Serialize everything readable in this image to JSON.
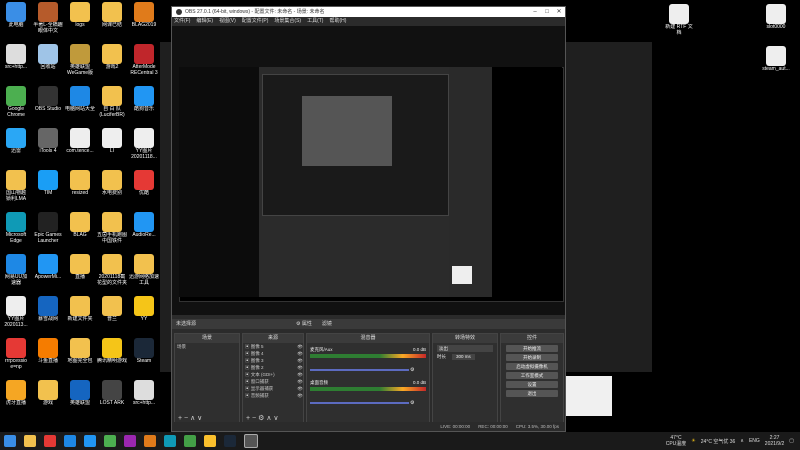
{
  "desktop_icons": [
    {
      "label": "此电脑",
      "icon": "computer-icon",
      "color": "#3a8ee6"
    },
    {
      "label": "半著L-全橋趣\n眼体中文",
      "icon": "game-icon",
      "color": "#b65b2b"
    },
    {
      "label": "logs",
      "icon": "folder-icon",
      "color": "#f2c14e"
    },
    {
      "label": "网课已结",
      "icon": "folder-icon",
      "color": "#f2c14e"
    },
    {
      "label": "BLAG2019",
      "icon": "app-icon",
      "color": "#e07b1b"
    },
    {
      "label": "src+http...",
      "icon": "file-icon",
      "color": "#ddd"
    },
    {
      "label": "回收站",
      "icon": "recycle-bin-icon",
      "color": "#9fc4e7"
    },
    {
      "label": "英雄联盟\nWeGame版",
      "icon": "game-icon",
      "color": "#c09a3b"
    },
    {
      "label": "游戏2",
      "icon": "folder-icon",
      "color": "#f2c14e"
    },
    {
      "label": "AtterMode\nRECentral 3",
      "icon": "app-icon",
      "color": "#c0262b"
    },
    {
      "label": "Google\nChrome",
      "icon": "chrome-icon",
      "color": "#4caf50"
    },
    {
      "label": "OBS Studio",
      "icon": "obs-icon",
      "color": "#333"
    },
    {
      "label": "电脑网站大全",
      "icon": "ie-icon",
      "color": "#1e88e5"
    },
    {
      "label": "自 白 队\n(LuciferBR)",
      "icon": "folder-icon",
      "color": "#f2c14e"
    },
    {
      "label": "酷狗音乐",
      "icon": "kugou-icon",
      "color": "#2196f3"
    },
    {
      "label": "迅雷",
      "icon": "thunder-icon",
      "color": "#2aa7f5"
    },
    {
      "label": "iTools 4",
      "icon": "itools-icon",
      "color": "#666"
    },
    {
      "label": "com.tence...",
      "icon": "file-icon",
      "color": "#eee"
    },
    {
      "label": "LI",
      "icon": "file-icon",
      "color": "#eee"
    },
    {
      "label": "YY图片\n20201118...",
      "icon": "image-icon",
      "color": "#eee"
    },
    {
      "label": "国山物越\n锁利LMA",
      "icon": "folder-icon",
      "color": "#f2c14e"
    },
    {
      "label": "TIM",
      "icon": "tim-icon",
      "color": "#1a9ef5"
    },
    {
      "label": "resized",
      "icon": "folder-icon",
      "color": "#f2c14e"
    },
    {
      "label": "水电费别",
      "icon": "folder-icon",
      "color": "#f2c14e"
    },
    {
      "label": "优酷",
      "icon": "youku-icon",
      "color": "#e53935"
    },
    {
      "label": "Microsoft\nEdge",
      "icon": "edge-icon",
      "color": "#0f9ab6"
    },
    {
      "label": "Epic Games\nLauncher",
      "icon": "epic-icon",
      "color": "#222"
    },
    {
      "label": "BLAG",
      "icon": "folder-icon",
      "color": "#f2c14e"
    },
    {
      "label": "五茵手机跑图\n中国铁件",
      "icon": "folder-icon",
      "color": "#f2c14e"
    },
    {
      "label": "AudioRe...",
      "icon": "audio-icon",
      "color": "#2196f3"
    },
    {
      "label": "网易UU加\n速器",
      "icon": "uu-icon",
      "color": "#1e88e5"
    },
    {
      "label": "ApowerMi...",
      "icon": "apowermirror-icon",
      "color": "#2196f3"
    },
    {
      "label": "直播",
      "icon": "folder-icon",
      "color": "#f2c14e"
    },
    {
      "label": "20201118截\n花型的文件夹",
      "icon": "folder-icon",
      "color": "#f2c14e"
    },
    {
      "label": "迅游网络加速\n工具",
      "icon": "folder-icon",
      "color": "#f2c14e"
    },
    {
      "label": "YY图片\n2020113...",
      "icon": "image-icon",
      "color": "#eee"
    },
    {
      "label": "暴雪战网",
      "icon": "battlenet-icon",
      "color": "#1565c0"
    },
    {
      "label": "新建文件夹",
      "icon": "folder-icon",
      "color": "#f2c14e"
    },
    {
      "label": "普兰",
      "icon": "folder-icon",
      "color": "#f2c14e"
    },
    {
      "label": "YY",
      "icon": "yy-icon",
      "color": "#f5c518"
    },
    {
      "label": "rrrpcessio\ne=np",
      "icon": "rubik-icon",
      "color": "#e53935"
    },
    {
      "label": "斗鱼直播",
      "icon": "douyu-icon",
      "color": "#f57c00"
    },
    {
      "label": "地图完全包",
      "icon": "folder-icon",
      "color": "#f2c14e"
    },
    {
      "label": "腾讯精明游戏",
      "icon": "tencent-icon",
      "color": "#f5c518"
    },
    {
      "label": "Steam",
      "icon": "steam-icon",
      "color": "#1b2838"
    },
    {
      "label": "虎牙直播",
      "icon": "huya-icon",
      "color": "#f5a623"
    },
    {
      "label": "游戏",
      "icon": "folder-icon",
      "color": "#f2c14e"
    },
    {
      "label": "英雄联盟",
      "icon": "lol-icon",
      "color": "#1565c0"
    },
    {
      "label": "LOST ARK",
      "icon": "game-icon",
      "color": "#444"
    },
    {
      "label": "src+http...",
      "icon": "file-icon",
      "color": "#ddd"
    }
  ],
  "right_icons": [
    {
      "label": "新建 RTF 文\n档",
      "icon": "rtf-icon",
      "color": "#eee"
    },
    {
      "label": "slot0000",
      "icon": "file-icon",
      "color": "#eee"
    },
    {
      "label": "steam_aut...",
      "icon": "file-icon",
      "color": "#eee"
    }
  ],
  "obs": {
    "title": "OBS 27.0.1 (64-bit, windows) - 配置文件: 未命名 - 场景: 未命名",
    "menu": [
      "文件(F)",
      "编辑(E)",
      "视图(V)",
      "配置文件(P)",
      "场景集合(S)",
      "工具(T)",
      "帮助(H)"
    ],
    "scene_bar_label": "未选择源",
    "scene_bar_props": "⚙ 属性",
    "scene_bar_filters": "滤镜",
    "docks": {
      "scenes_title": "场景",
      "scene_item": "场景",
      "sources_title": "来源",
      "sources": [
        "图像 5",
        "图像 4",
        "图像 3",
        "图像 2",
        "文本 (GDI+)",
        "窗口捕获",
        "显示器捕获",
        "音频捕获"
      ],
      "mixer_title": "混音器",
      "mixer_channels": [
        {
          "name": "麦克风/Aux",
          "db": "0.0 dB"
        },
        {
          "name": "桌面音频",
          "db": "0.0 dB"
        }
      ],
      "transitions_title": "转场特效",
      "transition_type": "淡出",
      "duration_label": "时长",
      "duration_value": "300 ms",
      "controls_title": "控件",
      "controls": [
        "开始推流",
        "开始录制",
        "启动虚拟摄像机",
        "工作室模式",
        "设置",
        "退出"
      ]
    },
    "status": {
      "live": "LIVE: 00:00:00",
      "rec": "REC: 00:00:00",
      "cpu": "CPU: 3.5%, 30.00 fps"
    }
  },
  "taskbar": {
    "weather_temp": "47°C",
    "weather_label": "CPU温度",
    "outside_temp": "24°C 空气优 36",
    "lang": "ENG",
    "time": "2:27",
    "date": "2021/9/2"
  }
}
